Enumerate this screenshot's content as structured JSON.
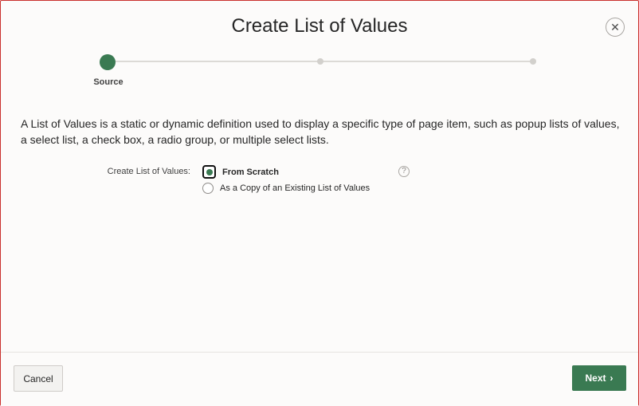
{
  "dialog": {
    "title": "Create List of Values",
    "close_glyph": "✕"
  },
  "wizard": {
    "steps": [
      {
        "label": "Source",
        "active": true
      },
      {
        "label": "",
        "active": false
      },
      {
        "label": "",
        "active": false
      }
    ]
  },
  "content": {
    "description": "A List of Values is a static or dynamic definition used to display a specific type of page item, such as popup lists of values, a select list, a check box, a radio group, or multiple select lists.",
    "field_label": "Create List of Values:",
    "options": [
      {
        "label": "From Scratch",
        "selected": true
      },
      {
        "label": "As a Copy of an Existing List of Values",
        "selected": false
      }
    ],
    "help_glyph": "?"
  },
  "footer": {
    "cancel_label": "Cancel",
    "next_label": "Next",
    "next_chevron": "›"
  },
  "colors": {
    "accent": "#3a7a52",
    "border_red": "#c9302c"
  }
}
